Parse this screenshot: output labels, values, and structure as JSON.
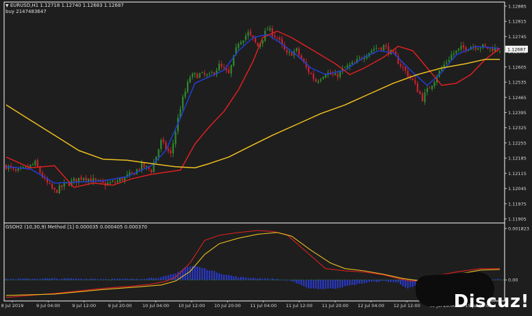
{
  "header": {
    "symbol_line": "EURUSD,H1  1.12718 1.12740 1.12683 1.12687",
    "order_line": "buy 2147483647",
    "dropdown_icon": "triangle-down-icon"
  },
  "indicator": {
    "label": "GSOH2 (10,30,9) Method [1] 0.000035 0.000405 0.000370"
  },
  "watermark": "Discuz!",
  "colors": {
    "background": "#1e1e1e",
    "frame": "#ffffff",
    "bull_candle": "#2e8b2e",
    "bear_candle": "#cc2230",
    "blue_line": "#1f3fd6",
    "red_line": "#e02020",
    "yellow_line": "#f0c020",
    "histogram": "#2a3ad8",
    "zero_line": "#2a8a2a"
  },
  "chart_data": [
    {
      "type": "candlestick",
      "title": "EURUSD,H1",
      "ylim": [
        1.11905,
        1.12885
      ],
      "yticks": [
        "1.12885",
        "1.12815",
        "1.12745",
        "1.12675",
        "1.12605",
        "1.12535",
        "1.12465",
        "1.12395",
        "1.12325",
        "1.12255",
        "1.12185",
        "1.12115",
        "1.12045",
        "1.11975",
        "1.11905"
      ],
      "current_price": "1.12687",
      "xticks": [
        "8 Jul 2019",
        "9 Jul 04:00",
        "9 Jul 12:00",
        "9 Jul 20:00",
        "10 Jul 04:00",
        "10 Jul 12:00",
        "10 Jul 20:00",
        "11 Jul 04:00",
        "11 Jul 12:00",
        "11 Jul 20:00",
        "12 Jul 04:00",
        "12 Jul 12:00",
        "12 Jul 20:00",
        "15 Jul 04:00"
      ],
      "close_anchors": [
        [
          0,
          1.1215
        ],
        [
          4,
          1.1212
        ],
        [
          8,
          1.12135
        ],
        [
          12,
          1.1216
        ],
        [
          16,
          1.1208
        ],
        [
          20,
          1.1203
        ],
        [
          24,
          1.1206
        ],
        [
          28,
          1.1208
        ],
        [
          32,
          1.121
        ],
        [
          36,
          1.1208
        ],
        [
          40,
          1.12065
        ],
        [
          44,
          1.1207
        ],
        [
          48,
          1.1209
        ],
        [
          52,
          1.1211
        ],
        [
          56,
          1.1215
        ],
        [
          60,
          1.1213
        ],
        [
          64,
          1.1226
        ],
        [
          68,
          1.122
        ],
        [
          72,
          1.1242
        ],
        [
          76,
          1.1256
        ],
        [
          80,
          1.1257
        ],
        [
          84,
          1.1256
        ],
        [
          88,
          1.1261
        ],
        [
          92,
          1.1257
        ],
        [
          96,
          1.1272
        ],
        [
          100,
          1.1276
        ],
        [
          104,
          1.127
        ],
        [
          108,
          1.1278
        ],
        [
          112,
          1.1274
        ],
        [
          116,
          1.1266
        ],
        [
          120,
          1.1268
        ],
        [
          124,
          1.126
        ],
        [
          128,
          1.1254
        ],
        [
          132,
          1.1258
        ],
        [
          136,
          1.1256
        ],
        [
          140,
          1.126
        ],
        [
          144,
          1.1262
        ],
        [
          148,
          1.1266
        ],
        [
          152,
          1.1269
        ],
        [
          156,
          1.127
        ],
        [
          160,
          1.1266
        ],
        [
          164,
          1.126
        ],
        [
          168,
          1.1254
        ],
        [
          172,
          1.1246
        ],
        [
          176,
          1.1253
        ],
        [
          180,
          1.126
        ],
        [
          184,
          1.1266
        ],
        [
          188,
          1.1269
        ],
        [
          192,
          1.127
        ],
        [
          196,
          1.127
        ],
        [
          200,
          1.1269
        ],
        [
          204,
          1.12687
        ]
      ],
      "series": [
        {
          "name": "",
          "style": "blue-line",
          "values": [
            [
              0,
              1.12145
            ],
            [
              10,
              1.12135
            ],
            [
              20,
              1.1207
            ],
            [
              30,
              1.12075
            ],
            [
              40,
              1.1208
            ],
            [
              50,
              1.121
            ],
            [
              60,
              1.1215
            ],
            [
              66,
              1.1222
            ],
            [
              72,
              1.1237
            ],
            [
              78,
              1.1253
            ],
            [
              84,
              1.1256
            ],
            [
              90,
              1.1259
            ],
            [
              96,
              1.1268
            ],
            [
              102,
              1.1274
            ],
            [
              108,
              1.12755
            ],
            [
              114,
              1.1271
            ],
            [
              120,
              1.1266
            ],
            [
              126,
              1.126
            ],
            [
              132,
              1.1257
            ],
            [
              140,
              1.1259
            ],
            [
              148,
              1.1265
            ],
            [
              154,
              1.1268
            ],
            [
              160,
              1.1267
            ],
            [
              168,
              1.1258
            ],
            [
              174,
              1.1252
            ],
            [
              180,
              1.1258
            ],
            [
              186,
              1.1266
            ],
            [
              194,
              1.127
            ],
            [
              204,
              1.1269
            ]
          ]
        },
        {
          "name": "",
          "style": "red-line",
          "values": [
            [
              0,
              1.1219
            ],
            [
              10,
              1.1214
            ],
            [
              20,
              1.1215
            ],
            [
              28,
              1.1205
            ],
            [
              36,
              1.1207
            ],
            [
              44,
              1.1206
            ],
            [
              52,
              1.1209
            ],
            [
              60,
              1.1211
            ],
            [
              66,
              1.1212
            ],
            [
              72,
              1.1213
            ],
            [
              78,
              1.1225
            ],
            [
              84,
              1.1233
            ],
            [
              90,
              1.124
            ],
            [
              96,
              1.125
            ],
            [
              102,
              1.1263
            ],
            [
              106,
              1.1274
            ],
            [
              112,
              1.1277
            ],
            [
              118,
              1.1274
            ],
            [
              124,
              1.127
            ],
            [
              130,
              1.1266
            ],
            [
              136,
              1.1262
            ],
            [
              142,
              1.1257
            ],
            [
              148,
              1.126
            ],
            [
              156,
              1.1265
            ],
            [
              162,
              1.127
            ],
            [
              168,
              1.1268
            ],
            [
              174,
              1.126
            ],
            [
              180,
              1.1252
            ],
            [
              186,
              1.1253
            ],
            [
              192,
              1.1257
            ],
            [
              198,
              1.1264
            ],
            [
              204,
              1.1269
            ]
          ]
        },
        {
          "name": "",
          "style": "yellow-line",
          "values": [
            [
              0,
              1.1243
            ],
            [
              10,
              1.1236
            ],
            [
              20,
              1.1229
            ],
            [
              30,
              1.1222
            ],
            [
              40,
              1.1218
            ],
            [
              50,
              1.12175
            ],
            [
              60,
              1.1216
            ],
            [
              70,
              1.12145
            ],
            [
              78,
              1.1214
            ],
            [
              84,
              1.1216
            ],
            [
              92,
              1.1219
            ],
            [
              100,
              1.12235
            ],
            [
              110,
              1.1229
            ],
            [
              120,
              1.1234
            ],
            [
              130,
              1.1239
            ],
            [
              140,
              1.1243
            ],
            [
              150,
              1.1248
            ],
            [
              160,
              1.1253
            ],
            [
              170,
              1.1257
            ],
            [
              180,
              1.126
            ],
            [
              190,
              1.1262
            ],
            [
              198,
              1.1264
            ],
            [
              204,
              1.1264
            ]
          ]
        }
      ]
    },
    {
      "type": "line",
      "title": "GSOH2 (10,30,9) Method [1]",
      "ylim": [
        -0.0006,
        0.001823
      ],
      "yticks": [
        "0.001823",
        "0.00"
      ],
      "series": [
        {
          "name": "",
          "style": "histogram",
          "values": [
            [
              0,
              3e-05
            ],
            [
              16,
              5e-05
            ],
            [
              36,
              4e-05
            ],
            [
              52,
              3e-05
            ],
            [
              64,
              9e-05
            ],
            [
              70,
              0.00022
            ],
            [
              74,
              0.00045
            ],
            [
              78,
              0.0005
            ],
            [
              82,
              0.0004
            ],
            [
              90,
              0.0002
            ],
            [
              96,
              0.0001
            ],
            [
              104,
              6e-05
            ],
            [
              112,
              3e-05
            ],
            [
              118,
              -4e-05
            ],
            [
              124,
              -0.00028
            ],
            [
              130,
              -0.00032
            ],
            [
              136,
              -0.0003
            ],
            [
              142,
              -0.0002
            ],
            [
              150,
              -8e-05
            ],
            [
              156,
              -4e-05
            ],
            [
              162,
              -0.0001
            ],
            [
              166,
              -0.0003
            ],
            [
              170,
              -0.0002
            ],
            [
              176,
              -4e-05
            ],
            [
              182,
              4e-05
            ],
            [
              188,
              6e-05
            ],
            [
              196,
              3e-05
            ],
            [
              204,
              2e-05
            ]
          ]
        },
        {
          "name": "",
          "style": "red-line",
          "values": [
            [
              0,
              -0.00062
            ],
            [
              20,
              -0.00048
            ],
            [
              40,
              -0.0003
            ],
            [
              52,
              -0.00022
            ],
            [
              60,
              -0.00015
            ],
            [
              66,
              -5e-05
            ],
            [
              70,
              0.0001
            ],
            [
              76,
              0.0006
            ],
            [
              82,
              0.0014
            ],
            [
              88,
              0.00158
            ],
            [
              96,
              0.00168
            ],
            [
              104,
              0.00175
            ],
            [
              110,
              0.00172
            ],
            [
              116,
              0.0016
            ],
            [
              124,
              0.001
            ],
            [
              132,
              0.0004
            ],
            [
              140,
              0.00032
            ],
            [
              148,
              0.00028
            ],
            [
              156,
              0.00018
            ],
            [
              162,
              5e-05
            ],
            [
              168,
              -5e-05
            ],
            [
              176,
              0.00012
            ],
            [
              186,
              0.00028
            ],
            [
              196,
              0.0004
            ],
            [
              204,
              0.0004
            ]
          ]
        },
        {
          "name": "",
          "style": "yellow-line",
          "values": [
            [
              0,
              -0.00055
            ],
            [
              20,
              -0.0005
            ],
            [
              40,
              -0.00034
            ],
            [
              56,
              -0.00024
            ],
            [
              64,
              -0.00018
            ],
            [
              70,
              -4e-05
            ],
            [
              76,
              0.0003
            ],
            [
              82,
              0.0009
            ],
            [
              88,
              0.00128
            ],
            [
              96,
              0.00148
            ],
            [
              104,
              0.00162
            ],
            [
              112,
              0.00168
            ],
            [
              118,
              0.00155
            ],
            [
              126,
              0.00105
            ],
            [
              134,
              0.0006
            ],
            [
              140,
              0.0004
            ],
            [
              148,
              0.00032
            ],
            [
              156,
              0.0002
            ],
            [
              164,
              5e-05
            ],
            [
              170,
              -2e-05
            ],
            [
              178,
              8e-05
            ],
            [
              188,
              0.00022
            ],
            [
              196,
              0.00035
            ],
            [
              204,
              0.00037
            ]
          ]
        }
      ]
    }
  ]
}
